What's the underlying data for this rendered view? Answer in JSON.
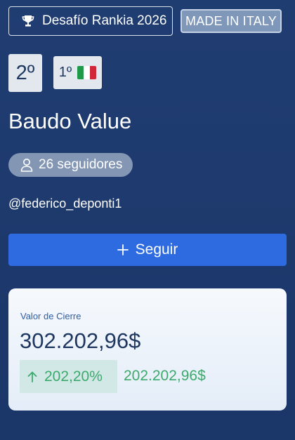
{
  "header": {
    "challenge_label": "Desafío Rankia 2026",
    "badge_label": "MADE IN ITALY"
  },
  "ranking": {
    "global_rank": "2º",
    "country_rank": "1º",
    "country_flag_icon": "italy-flag-icon"
  },
  "profile": {
    "portfolio_name": "Baudo Value",
    "followers_label": "26 seguidores",
    "handle": "@federico_deponti1"
  },
  "actions": {
    "follow_label": "Seguir"
  },
  "value_card": {
    "label": "Valor de Cierre",
    "amount": "302.202,96$",
    "change_percent": "202,20%",
    "change_amount": "202.202,96$"
  },
  "colors": {
    "background": "#1d3a6e",
    "primary_button": "#2e6be0",
    "positive": "#3caa6c",
    "pill": "#8396b4"
  }
}
